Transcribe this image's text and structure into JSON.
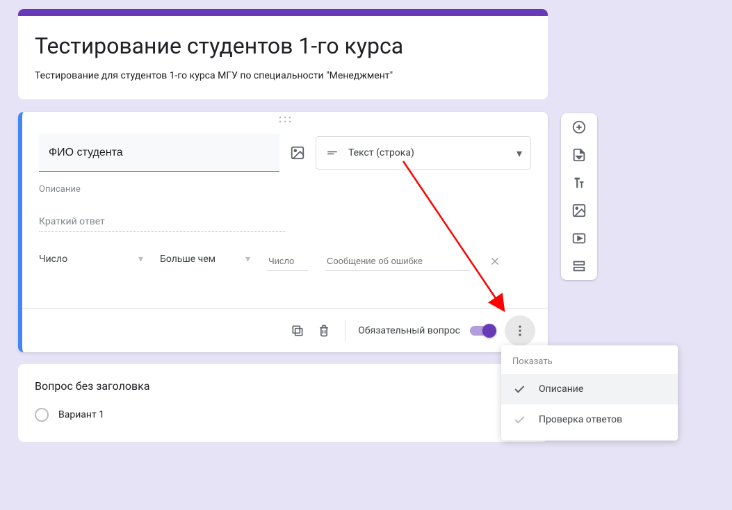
{
  "header": {
    "title": "Тестирование студентов 1-го курса",
    "description": "Тестирование для студентов 1-го курса МГУ по специальности \"Менеджмент\""
  },
  "question": {
    "title_value": "ФИО студента",
    "answer_type_label": "Текст (строка)",
    "description_placeholder": "Описание",
    "short_answer_placeholder": "Краткий ответ",
    "validation": {
      "type": "Число",
      "condition": "Больше чем",
      "number_placeholder": "Число",
      "error_placeholder": "Сообщение об ошибке"
    },
    "required_label": "Обязательный вопрос",
    "required_on": true
  },
  "second_question": {
    "title": "Вопрос без заголовка",
    "option1": "Вариант 1"
  },
  "popup": {
    "section_label": "Показать",
    "item_description": "Описание",
    "item_validation": "Проверка ответов"
  },
  "side_tooltips": {
    "add": "add-question-icon",
    "import": "import-questions-icon",
    "text": "add-title-icon",
    "image": "add-image-icon",
    "video": "add-video-icon",
    "section": "add-section-icon"
  }
}
